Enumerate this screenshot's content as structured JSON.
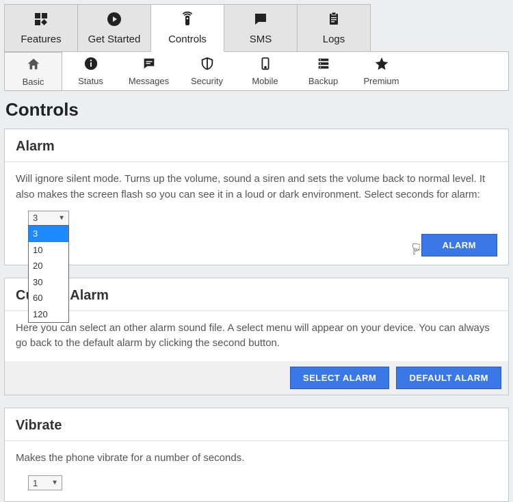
{
  "main_tabs": {
    "features": "Features",
    "get_started": "Get Started",
    "controls": "Controls",
    "sms": "SMS",
    "logs": "Logs"
  },
  "sub_tabs": {
    "basic": "Basic",
    "status": "Status",
    "messages": "Messages",
    "security": "Security",
    "mobile": "Mobile",
    "backup": "Backup",
    "premium": "Premium"
  },
  "page_title": "Controls",
  "alarm": {
    "title": "Alarm",
    "description": "Will ignore silent mode. Turns up the volume, sound a siren and sets the volume back to normal level. It also makes the screen flash so you can see it in a loud or dark environment. Select seconds for alarm:",
    "selected": "3",
    "options": [
      "3",
      "10",
      "20",
      "30",
      "60",
      "120"
    ],
    "button": "ALARM"
  },
  "custom_alarm": {
    "title": "Custom Alarm",
    "description": "Here you can select an other alarm sound file. A select menu will appear on your device. You can always go back to the default alarm by clicking the second button.",
    "select_button": "SELECT ALARM",
    "default_button": "DEFAULT ALARM"
  },
  "vibrate": {
    "title": "Vibrate",
    "description": "Makes the phone vibrate for a number of seconds.",
    "selected": "1"
  }
}
